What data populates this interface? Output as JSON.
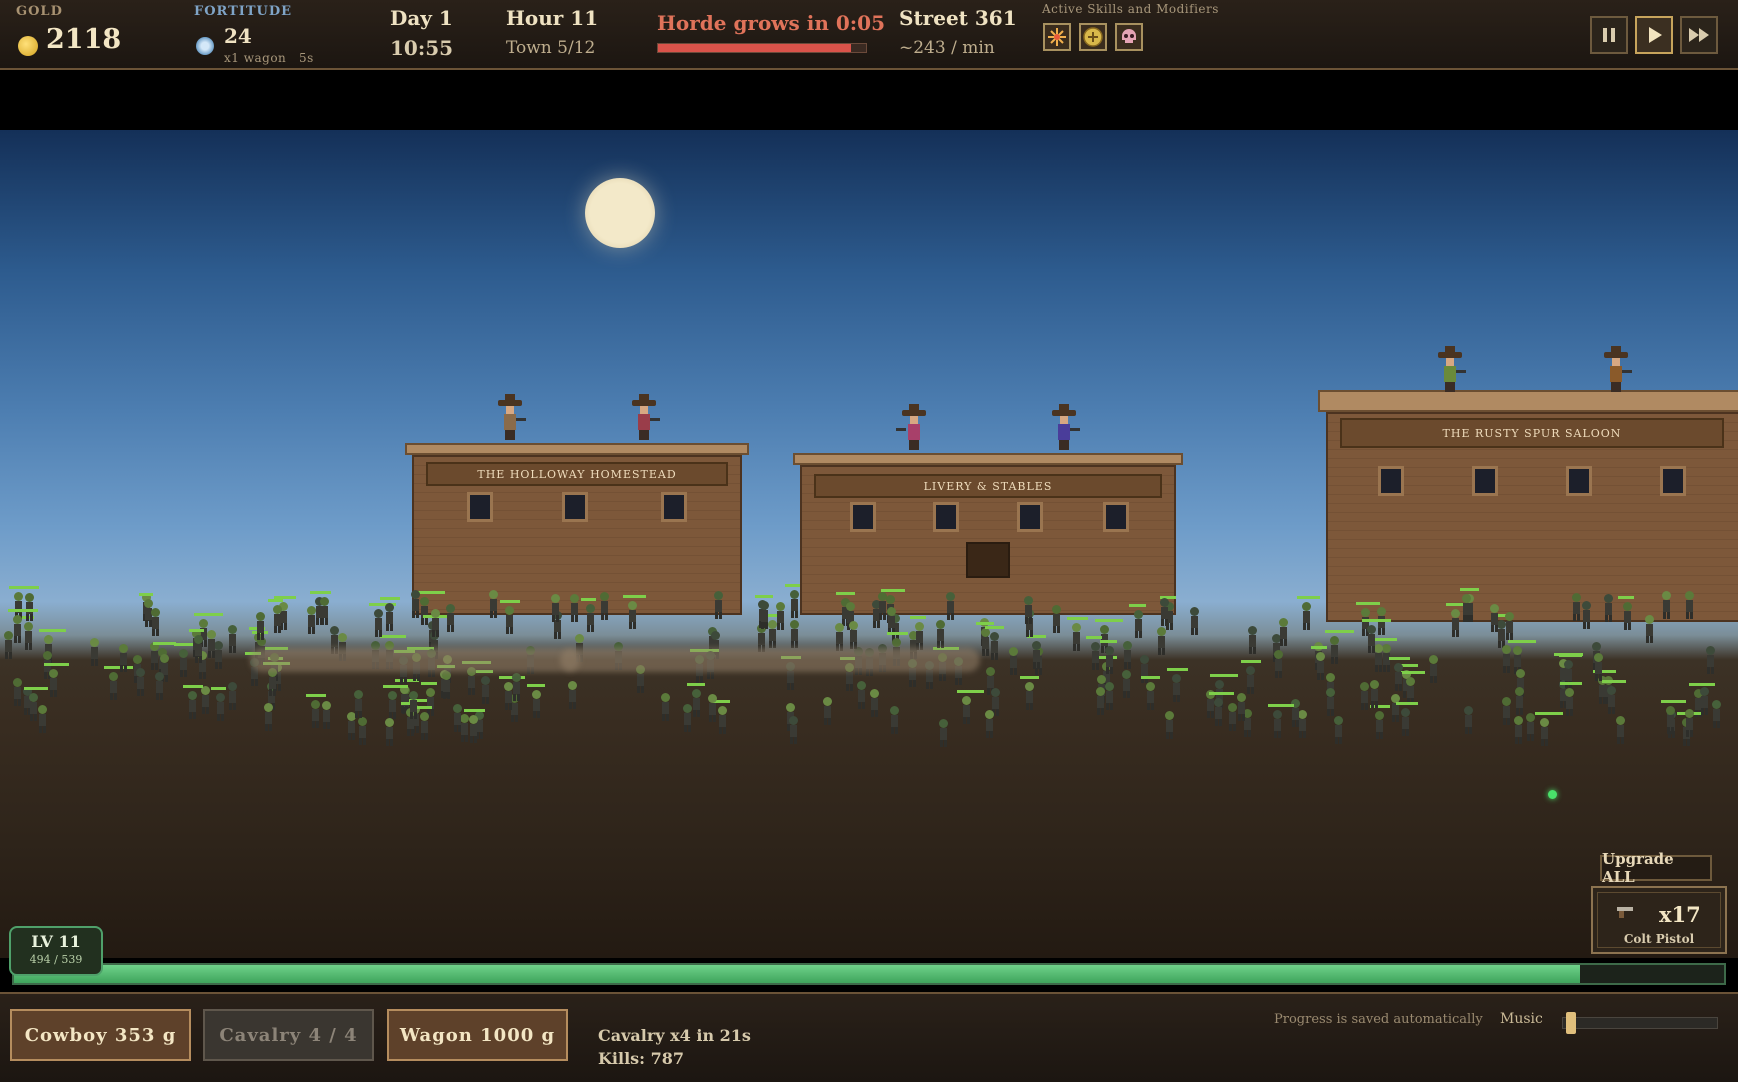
{
  "hud": {
    "gold_label": "GOLD",
    "gold_value": "2118",
    "fortitude_label": "FORTITUDE",
    "fortitude_value": "24",
    "fortitude_sub": "x1 wagon",
    "fortitude_timer": "5s",
    "day": "Day 1",
    "clock": "10:55",
    "hour": "Hour 11",
    "town": "Town 5/12",
    "horde_text": "Horde grows in 0:05",
    "horde_progress": 0.93,
    "street": "Street  361",
    "rate": "~243 / min",
    "skills_label": "Active Skills and Modifiers",
    "skills": [
      "burst-icon",
      "coin-shield-icon",
      "skull-icon"
    ],
    "controls": [
      "pause-icon",
      "play-icon",
      "fast-forward-icon"
    ]
  },
  "buildings": [
    {
      "sign": "THE HOLLOWAY HOMESTEAD"
    },
    {
      "sign": "LIVERY & STABLES"
    },
    {
      "sign": "THE RUSTY SPUR SALOON"
    }
  ],
  "weapon": {
    "upgrade_all": "Upgrade ALL",
    "count": "x17",
    "name": "Colt Pistol"
  },
  "level": {
    "label": "LV 11",
    "xp": "494 / 539",
    "progress": 0.916
  },
  "bottom": {
    "cowboy": "Cowboy  353 g",
    "cavalry": "Cavalry  4 / 4",
    "wagon": "Wagon  1000 g",
    "cavalry_info": "Cavalry x4 in 21s",
    "kills": "Kills: 787",
    "saved_note": "Progress is saved automatically",
    "music_label": "Music",
    "music_volume": 0.02
  },
  "colors": {
    "horde_text": "#e0735a",
    "xp_fill": "#4fbf6e",
    "zombie": "#5b7a3a"
  }
}
